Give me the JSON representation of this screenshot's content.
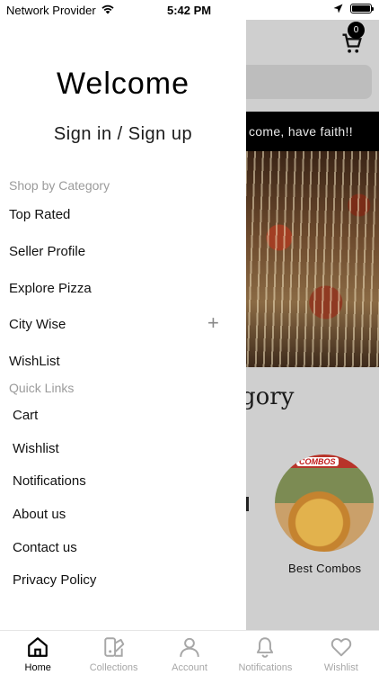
{
  "status_bar": {
    "carrier": "Network Provider",
    "time": "5:42 PM"
  },
  "drawer": {
    "welcome": "Welcome",
    "signin": "Sign in / Sign up",
    "shop_by_category": {
      "title": "Shop by Category",
      "items": [
        "Top Rated",
        "Seller Profile",
        "Explore Pizza",
        "City Wise",
        "WishList"
      ]
    },
    "quick_links": {
      "title": "Quick Links",
      "items": [
        "Cart",
        "Wishlist",
        "Notifications",
        "About us",
        "Contact us",
        "Privacy Policy"
      ]
    }
  },
  "background": {
    "cart_count": "0",
    "banner_text": "come, have faith!!",
    "category_heading": "gory",
    "category_card_title": "COMBOS",
    "category_card_label": "Best Combos"
  },
  "tab_bar": {
    "items": [
      {
        "label": "Home",
        "icon": "home-icon",
        "active": true
      },
      {
        "label": "Collections",
        "icon": "collections-icon",
        "active": false
      },
      {
        "label": "Account",
        "icon": "account-icon",
        "active": false
      },
      {
        "label": "Notifications",
        "icon": "bell-icon",
        "active": false
      },
      {
        "label": "Wishlist",
        "icon": "heart-icon",
        "active": false
      }
    ]
  },
  "colors": {
    "inactive_tab": "#a7a7a7",
    "section_title": "#9b9b9b",
    "banner_bg": "#000000",
    "overlay": "#cfcfcf"
  }
}
